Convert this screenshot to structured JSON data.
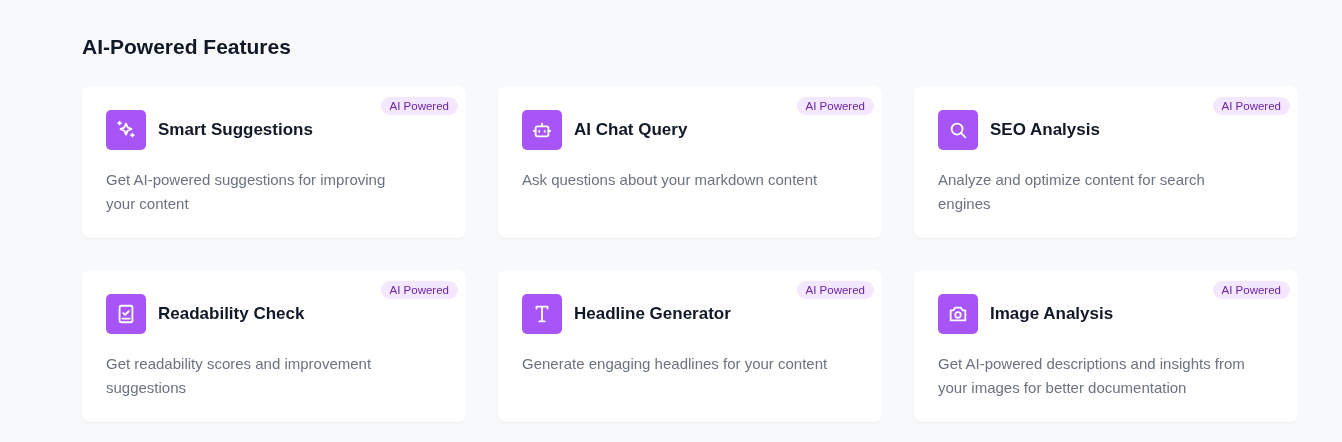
{
  "section": {
    "title": "AI-Powered Features"
  },
  "features": [
    {
      "title": "Smart Suggestions",
      "badge": "AI Powered",
      "description": "Get AI-powered suggestions for improving your content"
    },
    {
      "title": "AI Chat Query",
      "badge": "AI Powered",
      "description": "Ask questions about your markdown content"
    },
    {
      "title": "SEO Analysis",
      "badge": "AI Powered",
      "description": "Analyze and optimize content for search engines"
    },
    {
      "title": "Readability Check",
      "badge": "AI Powered",
      "description": "Get readability scores and improvement suggestions"
    },
    {
      "title": "Headline Generator",
      "badge": "AI Powered",
      "description": "Generate engaging headlines for your content"
    },
    {
      "title": "Image Analysis",
      "badge": "AI Powered",
      "description": "Get AI-powered descriptions and insights from your images for better documentation"
    }
  ]
}
